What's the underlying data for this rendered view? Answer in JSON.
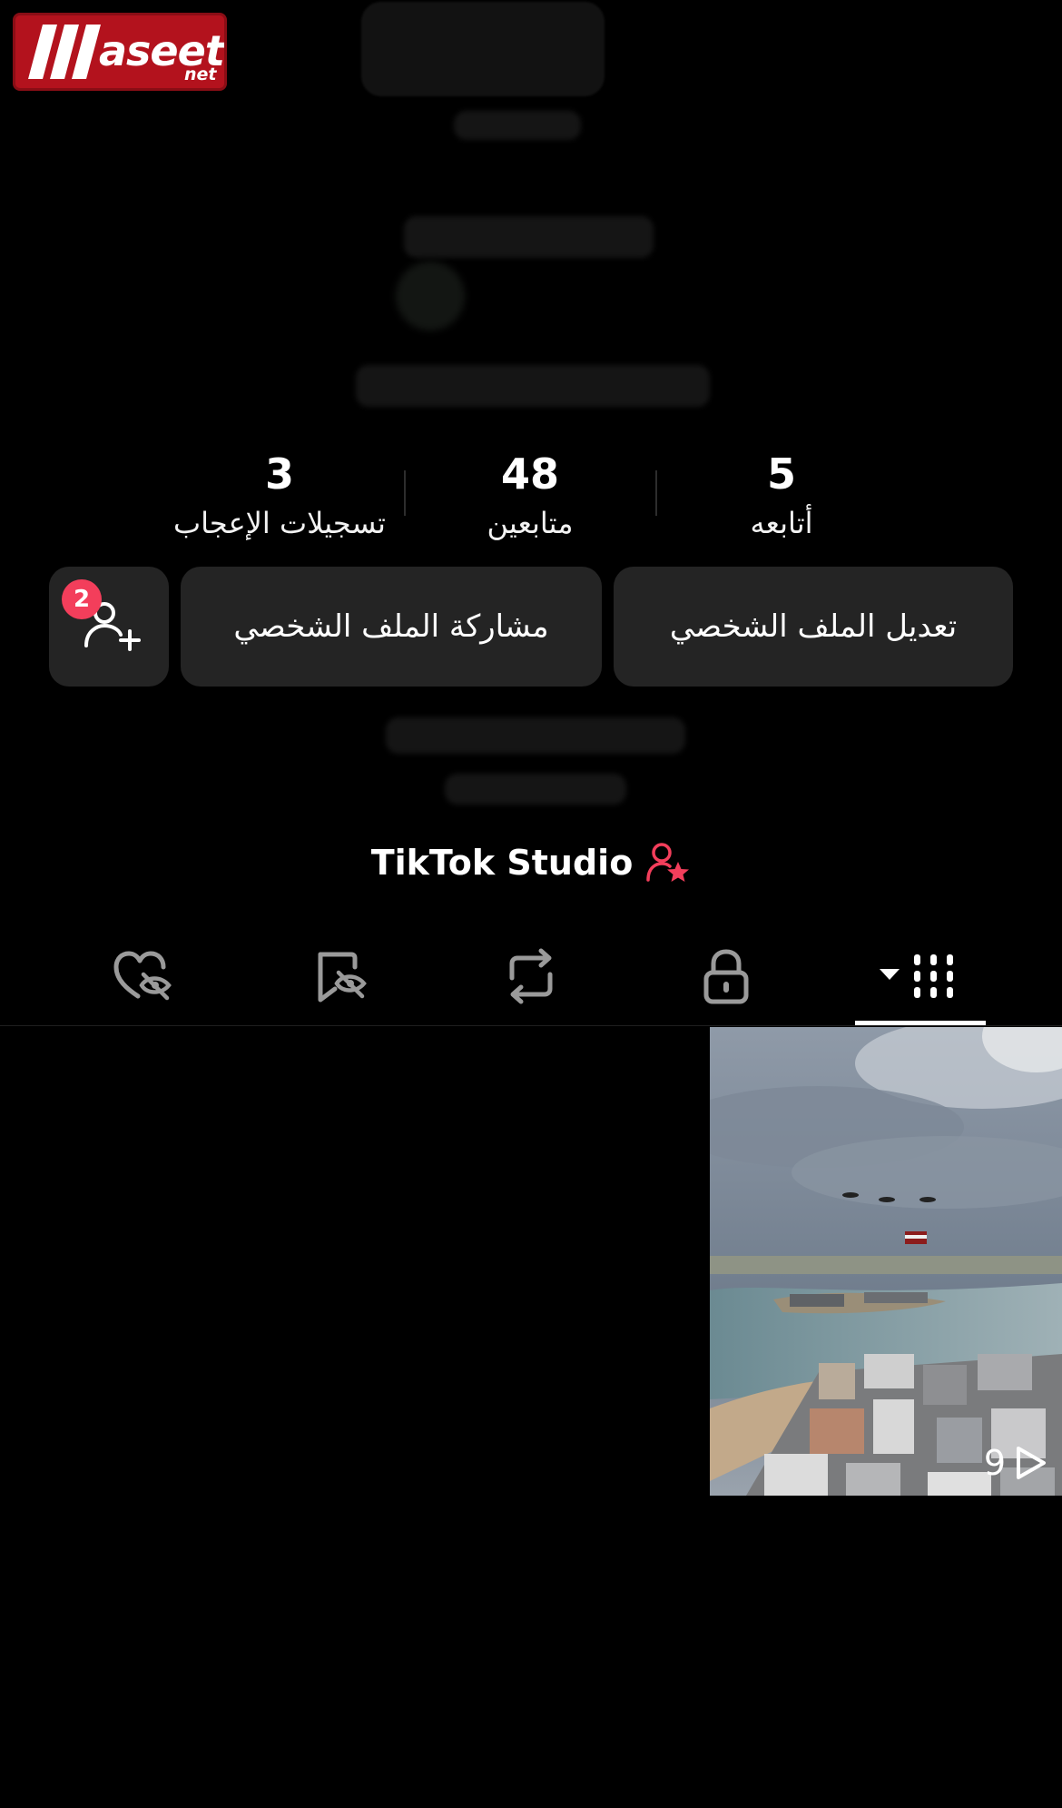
{
  "watermark": {
    "brand_word": "aseet",
    "brand_suffix": "net"
  },
  "stats": [
    {
      "value": "5",
      "label": "أتابعه"
    },
    {
      "value": "48",
      "label": "متابعين"
    },
    {
      "value": "3",
      "label": "تسجيلات الإعجاب"
    }
  ],
  "buttons": {
    "edit_profile": "تعديل الملف الشخصي",
    "share_profile": "مشاركة الملف الشخصي",
    "friend_requests_badge": "2"
  },
  "studio": {
    "label": "TikTok Studio",
    "icon": "person-star-icon"
  },
  "tabs": [
    {
      "icon": "grid-icon",
      "active": true
    },
    {
      "icon": "lock-icon",
      "active": false
    },
    {
      "icon": "repost-icon",
      "active": false
    },
    {
      "icon": "bookmark-hidden-icon",
      "active": false
    },
    {
      "icon": "heart-hidden-icon",
      "active": false
    }
  ],
  "videos": [
    {
      "views": "9"
    }
  ],
  "colors": {
    "background": "#000000",
    "button": "#242424",
    "accent": "#f33e5b"
  }
}
